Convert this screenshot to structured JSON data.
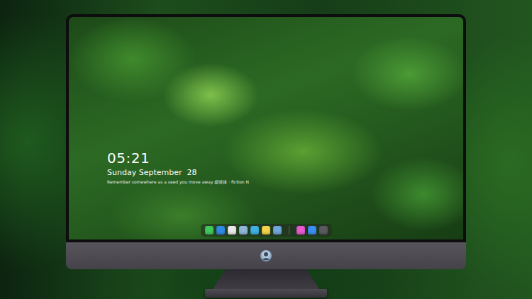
{
  "clock": {
    "time": "05:21",
    "date": "Sunday September  28",
    "caption": "Remember somewhere as a seed you move away 超链接 · fiction N"
  },
  "dock": {
    "apps": [
      {
        "color": "#3ec95a"
      },
      {
        "color": "#2f8be6"
      },
      {
        "color": "#e9e9e9"
      },
      {
        "color": "#8fb6d8"
      },
      {
        "color": "#3fb0e0"
      },
      {
        "color": "#f4d24a"
      },
      {
        "color": "#6fa7d9"
      }
    ],
    "recent": [
      {
        "color": "#e85ad0"
      },
      {
        "color": "#3a8ff0"
      },
      {
        "color": "#5a5a60"
      }
    ]
  }
}
